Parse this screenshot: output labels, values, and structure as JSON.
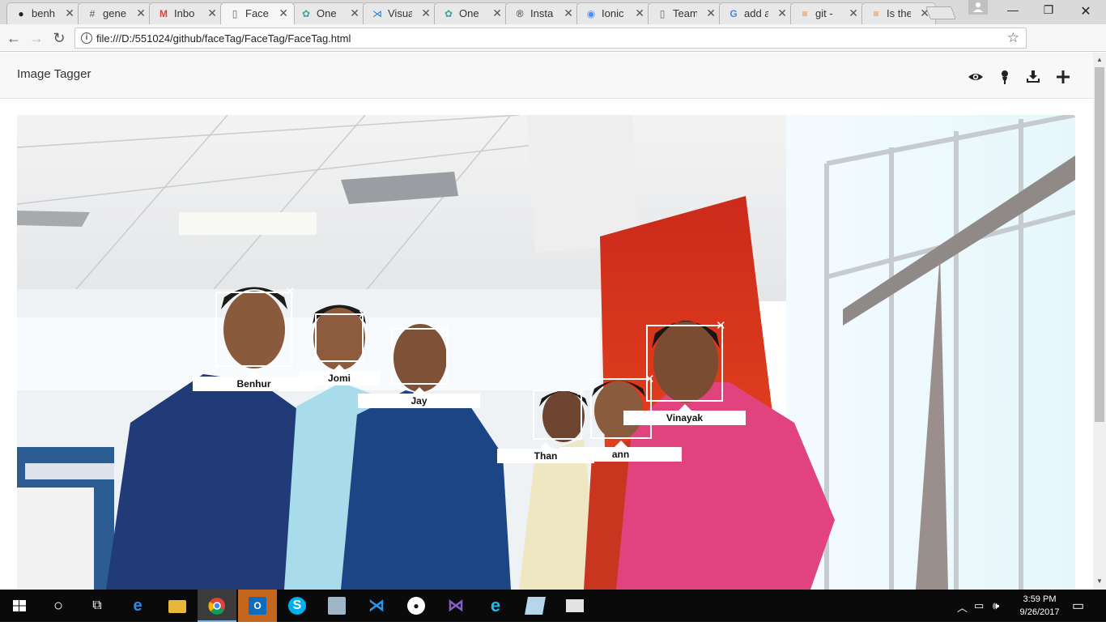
{
  "browser": {
    "tabs": [
      {
        "title": "benh",
        "icon": "github-icon",
        "active": false
      },
      {
        "title": "gene",
        "icon": "slack-icon",
        "active": false
      },
      {
        "title": "Inbo",
        "icon": "gmail-icon",
        "active": false
      },
      {
        "title": "Face",
        "icon": "page-icon",
        "active": true
      },
      {
        "title": "One",
        "icon": "spinner-icon",
        "active": false
      },
      {
        "title": "Visua",
        "icon": "vscode-icon",
        "active": false
      },
      {
        "title": "One",
        "icon": "spinner-icon",
        "active": false
      },
      {
        "title": "Insta",
        "icon": "rust-icon",
        "active": false
      },
      {
        "title": "Ionic",
        "icon": "ionic-icon",
        "active": false
      },
      {
        "title": "Team",
        "icon": "page-icon",
        "active": false
      },
      {
        "title": "add a",
        "icon": "google-icon",
        "active": false
      },
      {
        "title": "git -",
        "icon": "stackoverflow-icon",
        "active": false
      },
      {
        "title": "Is the",
        "icon": "stackoverflow-icon",
        "active": false
      }
    ],
    "url": "file:///D:/551024/github/faceTag/FaceTag/FaceTag.html"
  },
  "app": {
    "title": "Image Tagger",
    "toolbar_icons": [
      "eye-icon",
      "user-icon",
      "download-icon",
      "plus-icon"
    ]
  },
  "tags": [
    {
      "name": "Benhur",
      "close": "✕"
    },
    {
      "name": "Jomi",
      "close": "✕"
    },
    {
      "name": "Jay",
      "close": "✕"
    },
    {
      "name": "Than",
      "close": "✕"
    },
    {
      "name": "ann",
      "close": "✕"
    },
    {
      "name": "Vinayak",
      "close": "✕"
    }
  ],
  "taskbar": {
    "time": "3:59 PM",
    "date": "9/26/2017"
  }
}
